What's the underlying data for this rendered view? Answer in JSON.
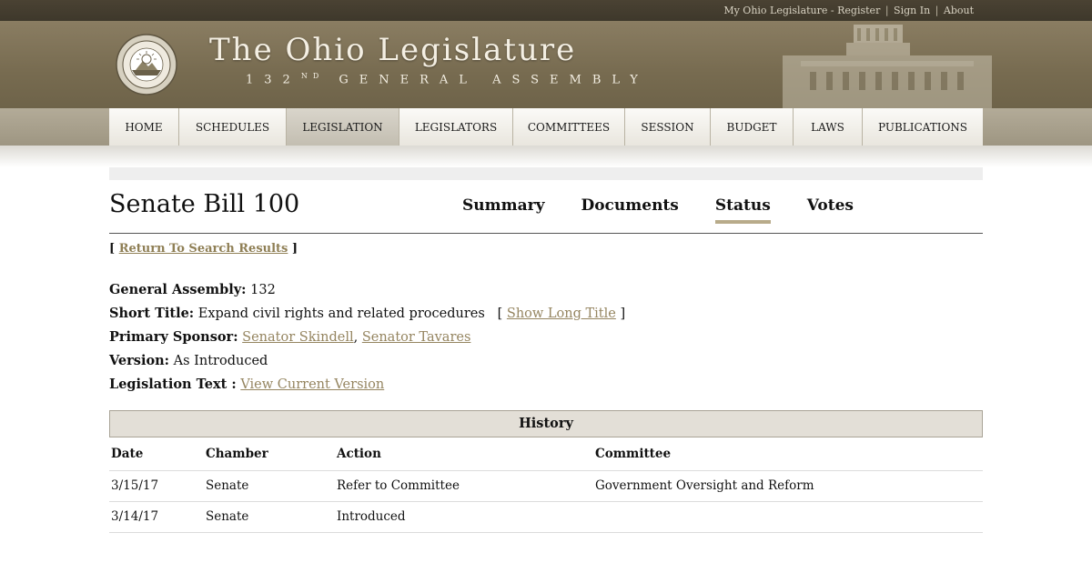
{
  "utility": {
    "my_ohio": "My Ohio Legislature",
    "dash": "-",
    "register": "Register",
    "sep1": "|",
    "sign_in": "Sign In",
    "sep2": "|",
    "about": "About"
  },
  "header": {
    "title": "The Ohio Legislature",
    "subtitle_num": "132",
    "subtitle_sup": "ND",
    "subtitle_rest": "GENERAL ASSEMBLY",
    "seal_icon": "ohio-general-assembly-seal"
  },
  "nav": [
    {
      "label": "HOME",
      "active": false
    },
    {
      "label": "SCHEDULES",
      "active": false
    },
    {
      "label": "LEGISLATION",
      "active": true
    },
    {
      "label": "LEGISLATORS",
      "active": false
    },
    {
      "label": "COMMITTEES",
      "active": false
    },
    {
      "label": "SESSION",
      "active": false
    },
    {
      "label": "BUDGET",
      "active": false
    },
    {
      "label": "LAWS",
      "active": false
    },
    {
      "label": "PUBLICATIONS",
      "active": false
    }
  ],
  "bill": {
    "title": "Senate Bill 100",
    "tabs": [
      {
        "label": "Summary",
        "active": false
      },
      {
        "label": "Documents",
        "active": false
      },
      {
        "label": "Status",
        "active": true
      },
      {
        "label": "Votes",
        "active": false
      }
    ],
    "return_open": "[",
    "return_link": "Return To Search Results",
    "return_close": "]"
  },
  "info": {
    "ga_label": "General Assembly:",
    "ga_value": "132",
    "short_title_label": "Short Title:",
    "short_title_value": "Expand civil rights and related procedures",
    "long_open": "[",
    "show_long_title": "Show Long Title",
    "long_close": "]",
    "sponsor_label": "Primary Sponsor:",
    "sponsor_1": "Senator Skindell",
    "sponsor_comma": ",",
    "sponsor_2": "Senator Tavares",
    "version_label": "Version:",
    "version_value": "As Introduced",
    "text_label": "Legislation Text :",
    "text_link": "View Current Version"
  },
  "history": {
    "title": "History",
    "columns": [
      "Date",
      "Chamber",
      "Action",
      "Committee"
    ],
    "rows": [
      [
        "3/15/17",
        "Senate",
        "Refer to Committee",
        "Government Oversight and Reform"
      ],
      [
        "3/14/17",
        "Senate",
        "Introduced",
        ""
      ]
    ]
  },
  "colors": {
    "link": "#958560",
    "active_tab_underline": "#b8ab8a",
    "banner": "#7d7156"
  }
}
